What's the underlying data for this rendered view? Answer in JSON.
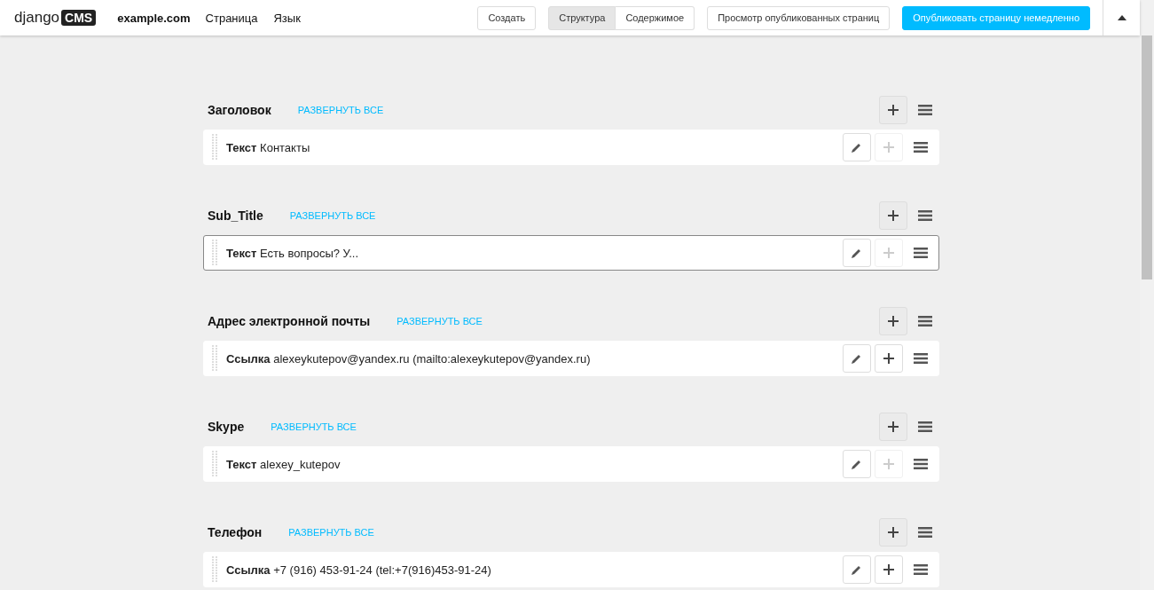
{
  "toolbar": {
    "logo_text": "django",
    "logo_badge": "CMS",
    "site": "example.com",
    "menu": [
      "Страница",
      "Язык"
    ],
    "create_button": "Создать",
    "mode_tabs": [
      {
        "label": "Структура",
        "selected": true
      },
      {
        "label": "Содержимое",
        "selected": false
      }
    ],
    "view_published_button": "Просмотр опубликованных страниц",
    "publish_button": "Опубликовать страницу немедленно"
  },
  "placeholders": [
    {
      "title": "Заголовок",
      "expand_link": "РАЗВЕРНУТЬ ВСЕ",
      "plugins": [
        {
          "type": "Текст",
          "text": "Контакты",
          "highlighted": false,
          "add_enabled": false
        }
      ]
    },
    {
      "title": "Sub_Title",
      "expand_link": "РАЗВЕРНУТЬ ВСЕ",
      "plugins": [
        {
          "type": "Текст",
          "text": "Есть вопросы? У...",
          "highlighted": true,
          "add_enabled": false
        }
      ]
    },
    {
      "title": "Адрес электронной почты",
      "expand_link": "РАЗВЕРНУТЬ ВСЕ",
      "plugins": [
        {
          "type": "Ссылка",
          "text": "alexeykutepov@yandex.ru (mailto:alexeykutepov@yandex.ru)",
          "highlighted": false,
          "add_enabled": true
        }
      ]
    },
    {
      "title": "Skype",
      "expand_link": "РАЗВЕРНУТЬ ВСЕ",
      "plugins": [
        {
          "type": "Текст",
          "text": "alexey_kutepov",
          "highlighted": false,
          "add_enabled": false
        }
      ]
    },
    {
      "title": "Телефон",
      "expand_link": "РАЗВЕРНУТЬ ВСЕ",
      "plugins": [
        {
          "type": "Ссылка",
          "text": "+7 (916) 453-91-24 (tel:+7(916)453-91-24)",
          "highlighted": false,
          "add_enabled": true
        }
      ]
    }
  ]
}
